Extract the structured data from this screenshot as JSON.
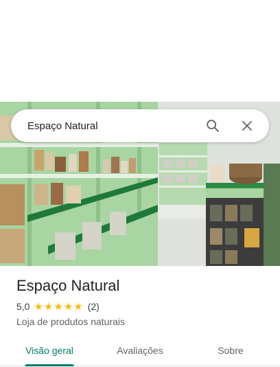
{
  "search": {
    "value": "Espaço Natural"
  },
  "place": {
    "name": "Espaço Natural",
    "rating": "5,0",
    "stars": 5,
    "review_count": "(2)",
    "category": "Loja de produtos naturais"
  },
  "tabs": [
    {
      "label": "Visão geral",
      "active": true
    },
    {
      "label": "Avaliações",
      "active": false
    },
    {
      "label": "Sobre",
      "active": false
    }
  ],
  "colors": {
    "accent": "#00796b",
    "star": "#fbbc04",
    "shelf": "#a8d5a2"
  },
  "icons": [
    "search-icon",
    "close-icon",
    "star-icon"
  ]
}
